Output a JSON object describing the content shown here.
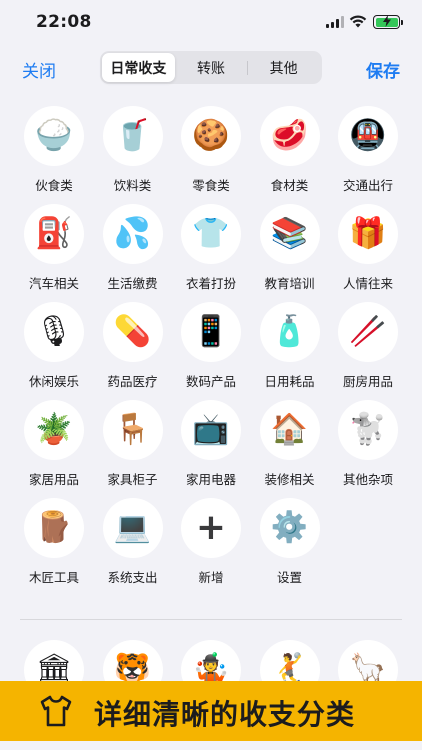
{
  "status_bar": {
    "time": "22:08"
  },
  "nav": {
    "close_label": "关闭",
    "save_label": "保存",
    "tabs": [
      {
        "label": "日常收支",
        "active": true
      },
      {
        "label": "转账",
        "active": false
      },
      {
        "label": "其他",
        "active": false
      }
    ]
  },
  "categories": [
    {
      "label": "伙食类",
      "icon": "rice-bowl-icon",
      "glyph": "🍚"
    },
    {
      "label": "饮料类",
      "icon": "drink-cup-icon",
      "glyph": "🥤"
    },
    {
      "label": "零食类",
      "icon": "cookie-icon",
      "glyph": "🍪"
    },
    {
      "label": "食材类",
      "icon": "meat-icon",
      "glyph": "🥩"
    },
    {
      "label": "交通出行",
      "icon": "metro-icon",
      "glyph": "🚇"
    },
    {
      "label": "汽车相关",
      "icon": "fuel-pump-icon",
      "glyph": "⛽"
    },
    {
      "label": "生活缴费",
      "icon": "water-drops-icon",
      "glyph": "💦"
    },
    {
      "label": "衣着打扮",
      "icon": "shirt-icon",
      "glyph": "👕"
    },
    {
      "label": "教育培训",
      "icon": "books-icon",
      "glyph": "📚"
    },
    {
      "label": "人情往来",
      "icon": "gift-icon",
      "glyph": "🎁"
    },
    {
      "label": "休闲娱乐",
      "icon": "microphone-icon",
      "glyph": "🎙"
    },
    {
      "label": "药品医疗",
      "icon": "pill-icon",
      "glyph": "💊"
    },
    {
      "label": "数码产品",
      "icon": "phone-icon",
      "glyph": "📱"
    },
    {
      "label": "日用耗品",
      "icon": "lotion-bottle-icon",
      "glyph": "🧴"
    },
    {
      "label": "厨房用品",
      "icon": "chopsticks-icon",
      "glyph": "🥢"
    },
    {
      "label": "家居用品",
      "icon": "potted-plant-icon",
      "glyph": "🪴"
    },
    {
      "label": "家具柜子",
      "icon": "chair-icon",
      "glyph": "🪑"
    },
    {
      "label": "家用电器",
      "icon": "television-icon",
      "glyph": "📺"
    },
    {
      "label": "装修相关",
      "icon": "house-icon",
      "glyph": "🏠"
    },
    {
      "label": "其他杂项",
      "icon": "poodle-icon",
      "glyph": "🐩"
    },
    {
      "label": "木匠工具",
      "icon": "wood-logs-icon",
      "glyph": "🪵"
    },
    {
      "label": "系统支出",
      "icon": "laptop-icon",
      "glyph": "💻"
    },
    {
      "label": "新增",
      "icon": "plus-icon",
      "glyph": "+"
    },
    {
      "label": "设置",
      "icon": "gear-icon",
      "glyph": "⚙️"
    }
  ],
  "second_section": [
    {
      "icon": "classical-building-icon",
      "glyph": "🏛"
    },
    {
      "icon": "tiger-icon",
      "glyph": "🐯"
    },
    {
      "icon": "juggler-icon",
      "glyph": "🤹"
    },
    {
      "icon": "handball-icon",
      "glyph": "🤾"
    },
    {
      "icon": "llama-icon",
      "glyph": "🦙"
    }
  ],
  "banner": {
    "text": "详细清晰的收支分类",
    "icon": "t-shirt-icon"
  },
  "colors": {
    "accent": "#1e7cf2",
    "banner": "#f5b400",
    "background": "#f2f2f7",
    "battery": "#34c759"
  }
}
